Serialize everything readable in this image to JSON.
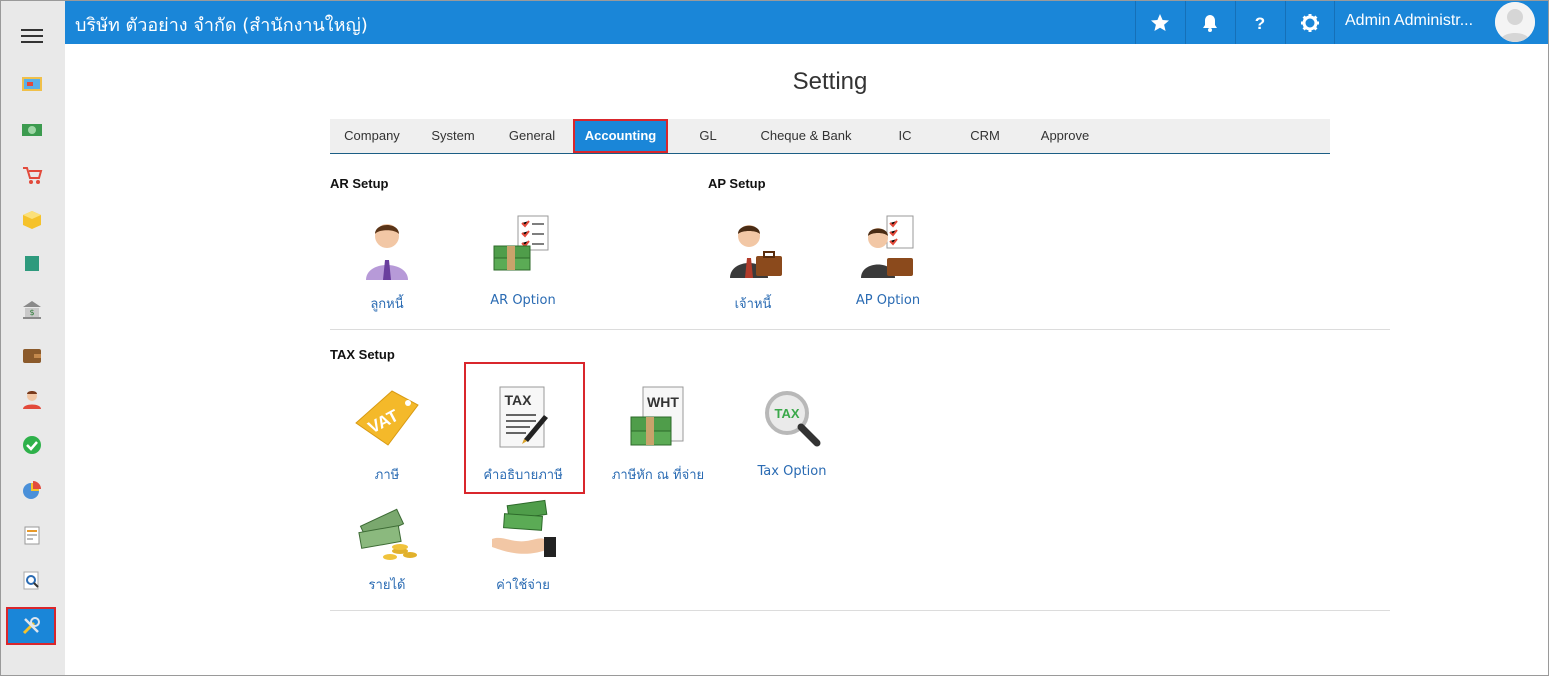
{
  "header": {
    "company": "บริษัท ตัวอย่าง จำกัด (สำนักงานใหญ่)",
    "user": "Admin Administr..."
  },
  "sidebar": {
    "items": [
      {
        "icon": "presentation-icon"
      },
      {
        "icon": "money-icon"
      },
      {
        "icon": "cart-icon"
      },
      {
        "icon": "box-icon"
      },
      {
        "icon": "book-icon"
      },
      {
        "icon": "bank-icon"
      },
      {
        "icon": "wallet-icon"
      },
      {
        "icon": "person-icon"
      },
      {
        "icon": "check-icon"
      },
      {
        "icon": "pie-chart-icon"
      },
      {
        "icon": "report-icon"
      },
      {
        "icon": "search-icon"
      },
      {
        "icon": "tools-icon"
      }
    ]
  },
  "page": {
    "title": "Setting"
  },
  "tabs": [
    {
      "label": "Company"
    },
    {
      "label": "System"
    },
    {
      "label": "General"
    },
    {
      "label": "Accounting",
      "active": true
    },
    {
      "label": "GL"
    },
    {
      "label": "Cheque & Bank"
    },
    {
      "label": "IC"
    },
    {
      "label": "CRM"
    },
    {
      "label": "Approve"
    }
  ],
  "ar_setup": {
    "title": "AR Setup",
    "items": [
      {
        "label": "ลูกหนี้",
        "icon": "customer-icon"
      },
      {
        "label": "AR Option",
        "icon": "ar-option-icon"
      }
    ]
  },
  "ap_setup": {
    "title": "AP Setup",
    "items": [
      {
        "label": "เจ้าหนี้",
        "icon": "creditor-icon"
      },
      {
        "label": "AP Option",
        "icon": "ap-option-icon"
      }
    ]
  },
  "tax_setup": {
    "title": "TAX Setup",
    "items": [
      {
        "label": "ภาษี",
        "icon": "vat-icon",
        "badge": "VAT"
      },
      {
        "label": "คำอธิบายภาษี",
        "icon": "tax-description-icon",
        "badge": "TAX"
      },
      {
        "label": "ภาษีหัก ณ ที่จ่าย",
        "icon": "wht-icon",
        "badge": "WHT"
      },
      {
        "label": "Tax Option",
        "icon": "tax-option-icon",
        "badge": "TAX"
      },
      {
        "label": "รายได้",
        "icon": "income-icon"
      },
      {
        "label": "ค่าใช้จ่าย",
        "icon": "expense-icon"
      }
    ]
  },
  "colors": {
    "primary": "#1a86d8",
    "highlight": "#d9262c",
    "link": "#2a6bb3"
  }
}
